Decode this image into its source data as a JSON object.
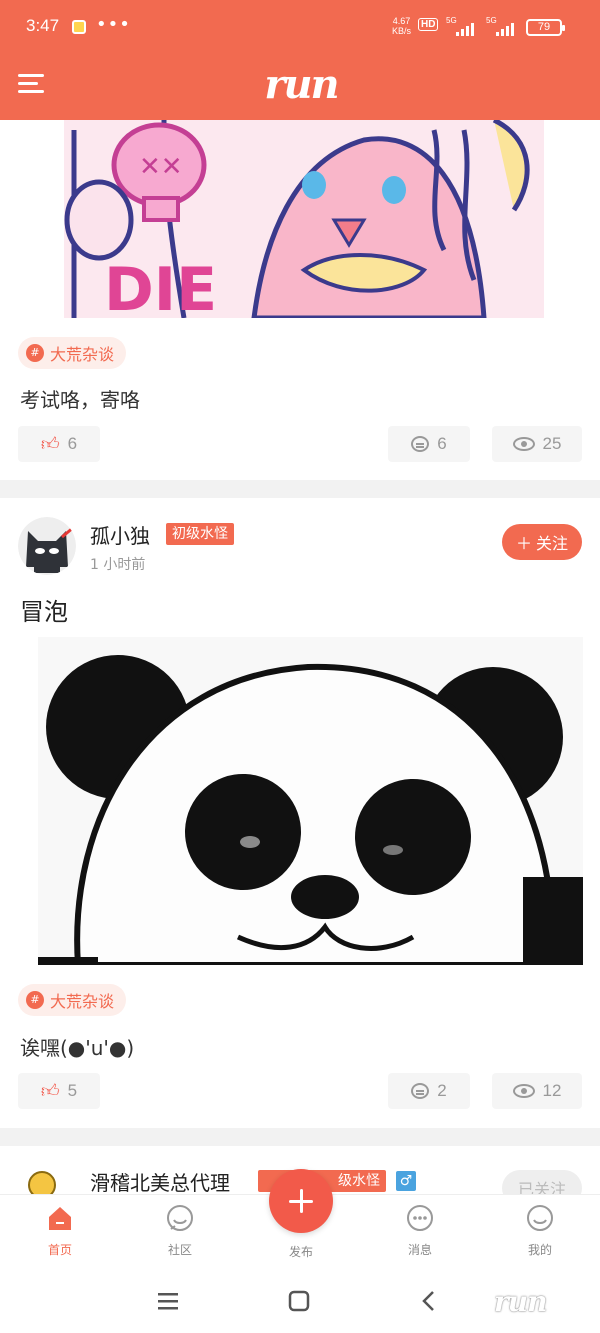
{
  "status_bar": {
    "time": "3:47",
    "net_speed": "4.67",
    "net_unit": "KB/s",
    "hd_label": "HD",
    "signal1_label": "5G",
    "signal2_label": "5G",
    "battery": "79"
  },
  "app_bar": {
    "logo_text": "run"
  },
  "feed": {
    "posts": [
      {
        "tag": "大荒杂谈",
        "text": "考试咯，寄咯",
        "likes": "6",
        "comments": "6",
        "views": "25"
      },
      {
        "author": "孤小独",
        "level": "初级水怪",
        "time": "1 小时前",
        "follow_label": "关注",
        "title": "冒泡",
        "tag": "大荒杂谈",
        "text": "诶嘿(●'u'●)",
        "likes": "5",
        "comments": "2",
        "views": "12"
      },
      {
        "author": "滑稽北美总代理",
        "level": "级水怪",
        "gender_icon": "♂",
        "follow_label": "已关注"
      }
    ]
  },
  "bottom_nav": {
    "items": [
      {
        "label": "首页",
        "icon": "home-icon"
      },
      {
        "label": "社区",
        "icon": "community-icon"
      },
      {
        "label": "发布",
        "icon": "plus-icon"
      },
      {
        "label": "消息",
        "icon": "message-icon"
      },
      {
        "label": "我的",
        "icon": "profile-icon"
      }
    ]
  },
  "watermark": "run",
  "colors": {
    "accent": "#f26a50",
    "like": "#f2574a",
    "tag_bg": "#fdeeea",
    "divider": "#f2f2f2"
  }
}
